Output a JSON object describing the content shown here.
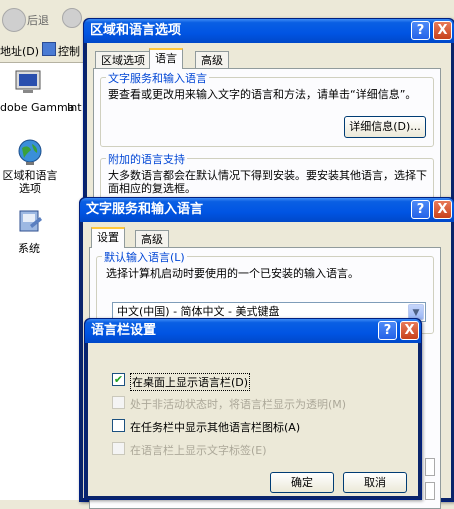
{
  "explorer": {
    "back_label": "后退",
    "address_label": "地址(D)",
    "address_value": "控制",
    "items": [
      {
        "label": "dobe Gamma"
      },
      {
        "label": "Int"
      },
      {
        "label": "区域和语言选项"
      },
      {
        "label": "系统"
      }
    ]
  },
  "regional_dialog": {
    "title": "区域和语言选项",
    "tabs": [
      "区域选项",
      "语言",
      "高级"
    ],
    "group1_title": "文字服务和输入语言",
    "group1_text": "要查看或更改用来输入文字的语言和方法，请单击“详细信息”。",
    "details_button": "详细信息(D)...",
    "group2_title": "附加的语言支持",
    "group2_text": "大多数语言都会在默认情况下得到安装。要安装其他语言，选择下面相应的复选框。"
  },
  "text_services_dialog": {
    "title": "文字服务和输入语言",
    "tabs": [
      "设置",
      "高级"
    ],
    "group_title": "默认输入语言(L)",
    "group_text": "选择计算机启动时要使用的一个已安装的输入语言。",
    "combo_value": "中文(中国) - 简体中文 - 美式键盘"
  },
  "langbar_dialog": {
    "title": "语言栏设置",
    "options": [
      {
        "label": "在桌面上显示语言栏(D)",
        "checked": "✔",
        "enabled": true
      },
      {
        "label": "处于非活动状态时，将语言栏显示为透明(M)",
        "checked": "",
        "enabled": false
      },
      {
        "label": "在任务栏中显示其他语言栏图标(A)",
        "checked": "",
        "enabled": true
      },
      {
        "label": "在语言栏上显示文字标签(E)",
        "checked": "",
        "enabled": false
      }
    ],
    "ok_button": "确定",
    "cancel_button": "取消"
  },
  "titlebar_buttons": {
    "help": "?",
    "close": "X"
  },
  "colors": {
    "title_blue": "#0054e3",
    "group_title": "#0046d5",
    "close_red": "#c7411b"
  }
}
